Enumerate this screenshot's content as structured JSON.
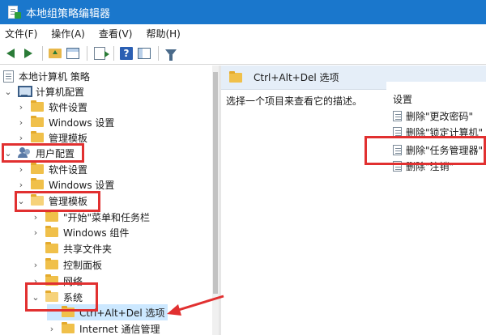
{
  "window": {
    "title": "本地组策略编辑器"
  },
  "menu": [
    "文件(F)",
    "操作(A)",
    "查看(V)",
    "帮助(H)"
  ],
  "toolbar": {
    "icons": [
      "back-arrow-icon",
      "forward-arrow-icon",
      "folder-up-icon",
      "grid-view-icon",
      "export-icon",
      "help-icon",
      "view-icon",
      "filter-icon"
    ],
    "help_glyph": "?"
  },
  "tree": {
    "root": "本地计算机 策略",
    "computer_config": "计算机配置",
    "cc_software": "软件设置",
    "cc_windows": "Windows 设置",
    "cc_admin": "管理模板",
    "user_config": "用户配置",
    "uc_software": "软件设置",
    "uc_windows": "Windows 设置",
    "uc_admin": "管理模板",
    "start_menu": "\"开始\"菜单和任务栏",
    "win_components": "Windows 组件",
    "shared_folders": "共享文件夹",
    "control_panel": "控制面板",
    "network": "网络",
    "system": "系统",
    "ctrl_alt_del": "Ctrl+Alt+Del 选项",
    "internet": "Internet 通信管理"
  },
  "glyphs": {
    "collapsed": "›",
    "expanded": "⌄"
  },
  "right": {
    "header": "Ctrl+Alt+Del 选项",
    "description": "选择一个项目来查看它的描述。",
    "column_header": "设置",
    "items": [
      "删除\"更改密码\"",
      "删除\"锁定计算机\"",
      "删除\"任务管理器\"",
      "删除\"注销\""
    ]
  },
  "annotation_color": "#e13030"
}
